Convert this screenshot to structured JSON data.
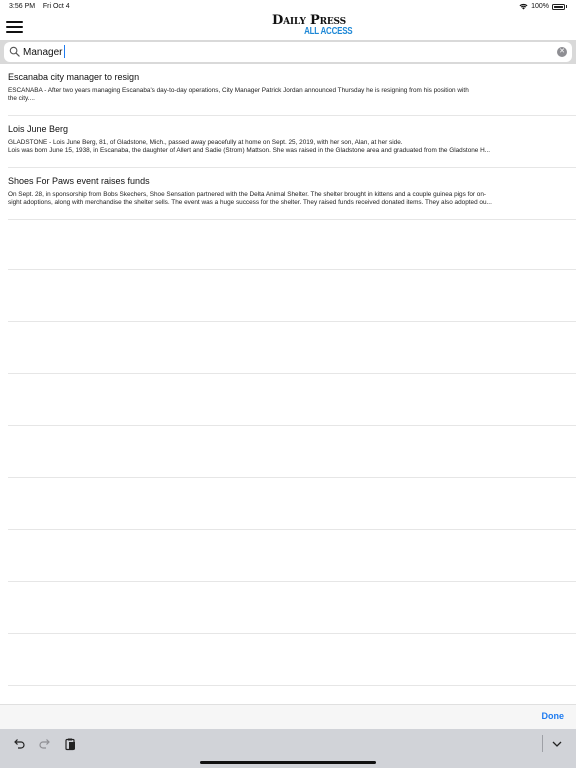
{
  "status": {
    "time": "3:56 PM",
    "date": "Fri Oct 4",
    "battery": "100%",
    "wifi_icon": "wifi-icon",
    "battery_icon": "battery-icon"
  },
  "header": {
    "menu_icon": "hamburger-menu-icon",
    "logo_top": "Daily Press",
    "logo_bottom": "ALL ACCESS",
    "logo_accent": "#1e88d6"
  },
  "search": {
    "value": "Manager",
    "search_icon": "search-icon",
    "clear_icon": "clear-icon"
  },
  "results": [
    {
      "title": "Escanaba city manager to resign",
      "body": "ESCANABA - After two years managing Escanaba's day-to-day operations, City Manager Patrick Jordan announced Thursday he is resigning from his position with\nthe city...."
    },
    {
      "title": "Lois June Berg",
      "body": "GLADSTONE - Lois June Berg, 81, of Gladstone, Mich., passed away peacefully at home on Sept. 25, 2019, with her son, Alan, at her side.\nLois was born June 15, 1938, in Escanaba, the daughter of Allert and Sadie (Strom) Mattson. She was raised in the Gladstone area and graduated from the Gladstone H..."
    },
    {
      "title": "Shoes For Paws event raises funds",
      "body": "On Sept. 28, in sponsorship from Bobs Skechers, Shoe Sensation partnered with the Delta Animal Shelter. The shelter brought in kittens and a couple guinea pigs for on-\nsight adoptions, along with merchandise the shelter sells. The event was a huge success for the shelter. They raised funds received donated items. They also adopted ou..."
    }
  ],
  "keyboard": {
    "done_label": "Done",
    "accent": "#1e7bf0",
    "undo_icon": "undo-icon",
    "redo_icon": "redo-icon",
    "paste_icon": "paste-icon",
    "dismiss_icon": "chevron-down-icon"
  }
}
